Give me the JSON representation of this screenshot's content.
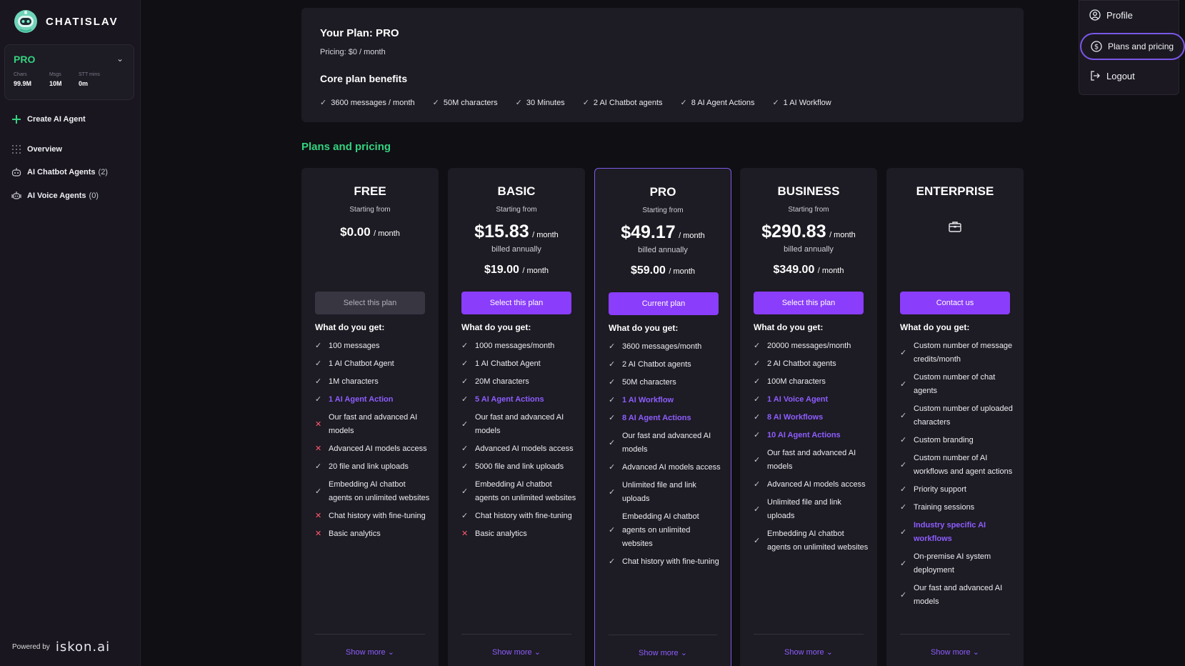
{
  "app": {
    "name": "CHATISLAV"
  },
  "sidebar": {
    "plan": {
      "name": "PRO",
      "stats": [
        {
          "label": "Chars",
          "value": "99.9M"
        },
        {
          "label": "Msgs",
          "value": "10M"
        },
        {
          "label": "STT mins",
          "value": "0m"
        }
      ]
    },
    "create_label": "Create AI Agent",
    "nav": [
      {
        "label": "Overview",
        "count": ""
      },
      {
        "label": "AI Chatbot Agents",
        "count": "(2)"
      },
      {
        "label": "AI Voice Agents",
        "count": "(0)"
      }
    ],
    "powered_by": "Powered by",
    "powered_logo": "iskon.ai"
  },
  "current_plan": {
    "title": "Your Plan: PRO",
    "pricing": "Pricing: $0 / month",
    "benefits_title": "Core plan benefits",
    "benefits": [
      "3600 messages / month",
      "50M characters",
      "30 Minutes",
      "2 AI Chatbot agents",
      "8 AI Agent Actions",
      "1 AI Workflow"
    ]
  },
  "section_title": "Plans and pricing",
  "plans": [
    {
      "name": "FREE",
      "from": "Starting from",
      "price": "$0.00",
      "per": "/ month",
      "billed": "",
      "annual_price": "",
      "annual_per": "",
      "button": "Select this plan",
      "button_state": "disabled",
      "features_title": "What do you get:",
      "features": [
        {
          "text": "100 messages",
          "ok": true,
          "highlight": false
        },
        {
          "text": "1 AI Chatbot Agent",
          "ok": true,
          "highlight": false
        },
        {
          "text": "1M characters",
          "ok": true,
          "highlight": false
        },
        {
          "text": "1 AI Agent Action",
          "ok": true,
          "highlight": true
        },
        {
          "text": "Our fast and advanced AI models",
          "ok": false,
          "highlight": false
        },
        {
          "text": "Advanced AI models access",
          "ok": false,
          "highlight": false
        },
        {
          "text": "20 file and link uploads",
          "ok": true,
          "highlight": false
        },
        {
          "text": "Embedding AI chatbot agents on unlimited websites",
          "ok": true,
          "highlight": false
        },
        {
          "text": "Chat history with fine-tuning",
          "ok": false,
          "highlight": false
        },
        {
          "text": "Basic analytics",
          "ok": false,
          "highlight": false
        }
      ],
      "show_more": "Show more"
    },
    {
      "name": "BASIC",
      "from": "Starting from",
      "price": "$15.83",
      "per": "/ month",
      "billed": "billed annually",
      "annual_price": "$19.00",
      "annual_per": "/ month",
      "button": "Select this plan",
      "button_state": "active",
      "features_title": "What do you get:",
      "features": [
        {
          "text": "1000 messages/month",
          "ok": true,
          "highlight": false
        },
        {
          "text": "1 AI Chatbot Agent",
          "ok": true,
          "highlight": false
        },
        {
          "text": "20M characters",
          "ok": true,
          "highlight": false
        },
        {
          "text": "5 AI Agent Actions",
          "ok": true,
          "highlight": true
        },
        {
          "text": "Our fast and advanced AI models",
          "ok": true,
          "highlight": false
        },
        {
          "text": "Advanced AI models access",
          "ok": true,
          "highlight": false
        },
        {
          "text": "5000 file and link uploads",
          "ok": true,
          "highlight": false
        },
        {
          "text": "Embedding AI chatbot agents on unlimited websites",
          "ok": true,
          "highlight": false
        },
        {
          "text": "Chat history with fine-tuning",
          "ok": true,
          "highlight": false
        },
        {
          "text": "Basic analytics",
          "ok": false,
          "highlight": false
        }
      ],
      "show_more": "Show more"
    },
    {
      "name": "PRO",
      "from": "Starting from",
      "price": "$49.17",
      "per": "/ month",
      "billed": "billed annually",
      "annual_price": "$59.00",
      "annual_per": "/ month",
      "button": "Current plan",
      "button_state": "active",
      "current": true,
      "features_title": "What do you get:",
      "features": [
        {
          "text": "3600 messages/month",
          "ok": true,
          "highlight": false
        },
        {
          "text": "2 AI Chatbot agents",
          "ok": true,
          "highlight": false
        },
        {
          "text": "50M characters",
          "ok": true,
          "highlight": false
        },
        {
          "text": "1 AI Workflow",
          "ok": true,
          "highlight": true
        },
        {
          "text": "8 AI Agent Actions",
          "ok": true,
          "highlight": true
        },
        {
          "text": "Our fast and advanced AI models",
          "ok": true,
          "highlight": false
        },
        {
          "text": "Advanced AI models access",
          "ok": true,
          "highlight": false
        },
        {
          "text": "Unlimited file and link uploads",
          "ok": true,
          "highlight": false
        },
        {
          "text": "Embedding AI chatbot agents on unlimited websites",
          "ok": true,
          "highlight": false
        },
        {
          "text": "Chat history with fine-tuning",
          "ok": true,
          "highlight": false
        }
      ],
      "show_more": "Show more"
    },
    {
      "name": "BUSINESS",
      "from": "Starting from",
      "price": "$290.83",
      "per": "/ month",
      "billed": "billed annually",
      "annual_price": "$349.00",
      "annual_per": "/ month",
      "button": "Select this plan",
      "button_state": "active",
      "features_title": "What do you get:",
      "features": [
        {
          "text": "20000 messages/month",
          "ok": true,
          "highlight": false
        },
        {
          "text": "2 AI Chatbot agents",
          "ok": true,
          "highlight": false
        },
        {
          "text": "100M characters",
          "ok": true,
          "highlight": false
        },
        {
          "text": "1 AI Voice Agent",
          "ok": true,
          "highlight": true
        },
        {
          "text": "8 AI Workflows",
          "ok": true,
          "highlight": true
        },
        {
          "text": "10 AI Agent Actions",
          "ok": true,
          "highlight": true
        },
        {
          "text": "Our fast and advanced AI models",
          "ok": true,
          "highlight": false
        },
        {
          "text": "Advanced AI models access",
          "ok": true,
          "highlight": false
        },
        {
          "text": "Unlimited file and link uploads",
          "ok": true,
          "highlight": false
        },
        {
          "text": "Embedding AI chatbot agents on unlimited websites",
          "ok": true,
          "highlight": false
        }
      ],
      "show_more": "Show more"
    },
    {
      "name": "ENTERPRISE",
      "from": "",
      "price": "",
      "per": "",
      "billed": "",
      "annual_price": "",
      "annual_per": "",
      "icon": "briefcase-icon",
      "button": "Contact us",
      "button_state": "active",
      "features_title": "What do you get:",
      "features": [
        {
          "text": "Custom number of message credits/month",
          "ok": true,
          "highlight": false
        },
        {
          "text": "Custom number of chat agents",
          "ok": true,
          "highlight": false
        },
        {
          "text": "Custom number of uploaded characters",
          "ok": true,
          "highlight": false
        },
        {
          "text": "Custom branding",
          "ok": true,
          "highlight": false
        },
        {
          "text": "Custom number of AI workflows and agent actions",
          "ok": true,
          "highlight": false
        },
        {
          "text": "Priority support",
          "ok": true,
          "highlight": false
        },
        {
          "text": "Training sessions",
          "ok": true,
          "highlight": false
        },
        {
          "text": "Industry specific AI workflows",
          "ok": true,
          "highlight": true
        },
        {
          "text": "On-premise AI system deployment",
          "ok": true,
          "highlight": false
        },
        {
          "text": "Our fast and advanced AI models",
          "ok": true,
          "highlight": false
        }
      ],
      "show_more": "Show more"
    }
  ],
  "menu": {
    "items": [
      {
        "label": "Profile",
        "icon": "user-circle-icon"
      },
      {
        "label": "Plans and pricing",
        "icon": "dollar-circle-icon",
        "active": true
      },
      {
        "label": "Logout",
        "icon": "logout-icon"
      }
    ]
  },
  "colors": {
    "accent": "#8a3dfa",
    "green": "#35d27f",
    "highlight": "#8d5dff",
    "error": "#ff5a6e"
  }
}
